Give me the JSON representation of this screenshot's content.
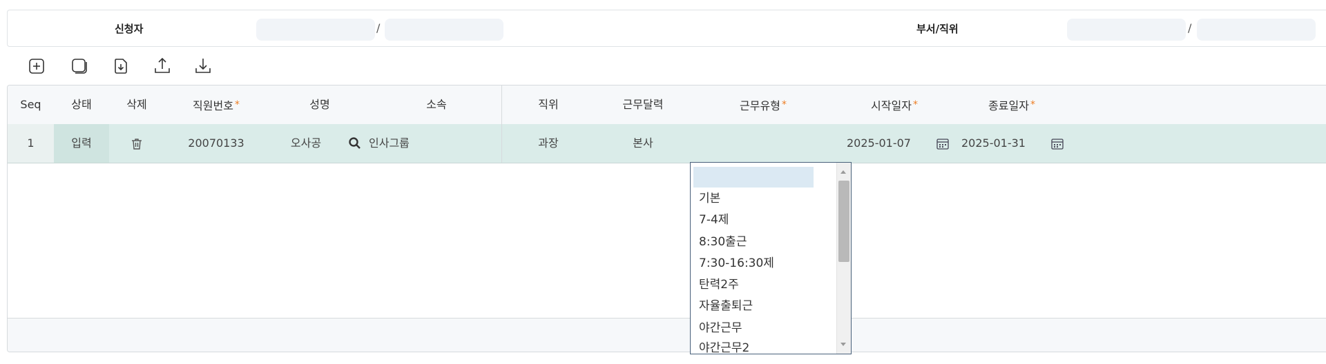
{
  "filter": {
    "applicant_label": "신청자",
    "dept_label": "부서/직위",
    "separator": "/",
    "applicant_id_value": "",
    "applicant_name_value": "",
    "dept_value": "",
    "position_value": ""
  },
  "toolbar": {
    "icons": [
      "add-icon",
      "copy-icon",
      "import-file-icon",
      "upload-icon",
      "download-icon"
    ]
  },
  "grid": {
    "columns": {
      "seq": "Seq",
      "status": "상태",
      "delete": "삭제",
      "emp_no": "직원번호",
      "name": "성명",
      "affiliation": "소속",
      "position": "직위",
      "work_calendar": "근무달력",
      "work_type": "근무유형",
      "start_date": "시작일자",
      "end_date": "종료일자"
    },
    "required_mark": "*",
    "row": {
      "seq": "1",
      "status": "입력",
      "emp_no": "20070133",
      "name": "오사공",
      "affiliation": "인사그룹",
      "position": "과장",
      "work_calendar": "본사",
      "work_type": "",
      "start_date": "2025-01-07",
      "end_date": "2025-01-31"
    }
  },
  "work_type_dropdown": {
    "options": [
      "",
      "기본",
      "7-4제",
      "8:30출근",
      "7:30-16:30제",
      "탄력2주",
      "자율출퇴근",
      "야간근무",
      "야간근무2"
    ],
    "selected_index": 0
  },
  "colors": {
    "row_highlight": "#daece9",
    "required_accent": "#ee7d22",
    "selected_option": "#dbe9f3",
    "border_dark": "#48607a"
  }
}
